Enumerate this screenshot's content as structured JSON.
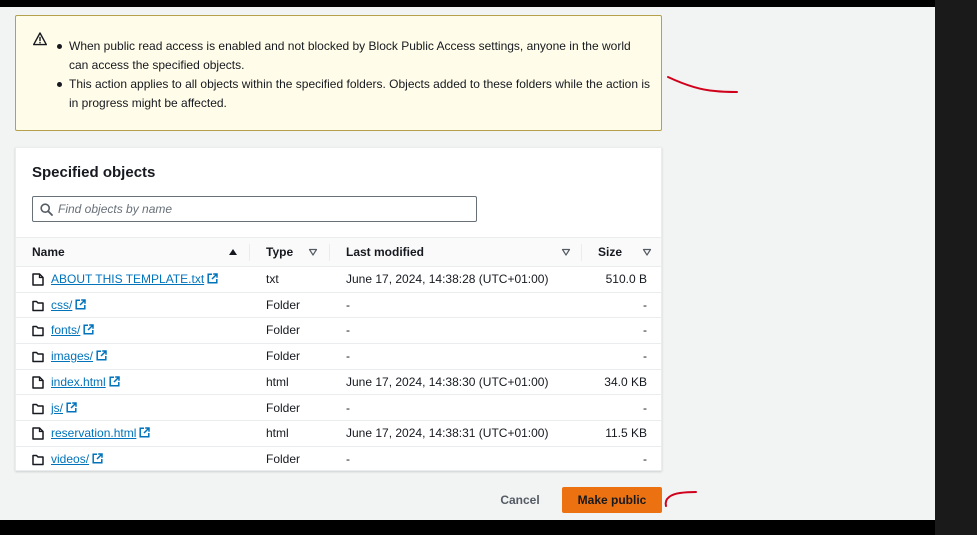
{
  "alert": {
    "icon": "warning-icon",
    "items": [
      "When public read access is enabled and not blocked by Block Public Access settings, anyone in the world can access the specified objects.",
      "This action applies to all objects within the specified folders. Objects added to these folders while the action is in progress might be affected."
    ]
  },
  "panel": {
    "title": "Specified objects",
    "search_placeholder": "Find objects by name",
    "search_value": "",
    "columns": {
      "name": "Name",
      "type": "Type",
      "last_modified": "Last modified",
      "size": "Size"
    },
    "rows": [
      {
        "name": "ABOUT THIS TEMPLATE.txt",
        "kind": "file",
        "type": "txt",
        "last_modified": "June 17, 2024, 14:38:28 (UTC+01:00)",
        "size": "510.0 B"
      },
      {
        "name": "css/",
        "kind": "folder",
        "type": "Folder",
        "last_modified": "-",
        "size": "-"
      },
      {
        "name": "fonts/",
        "kind": "folder",
        "type": "Folder",
        "last_modified": "-",
        "size": "-"
      },
      {
        "name": "images/",
        "kind": "folder",
        "type": "Folder",
        "last_modified": "-",
        "size": "-"
      },
      {
        "name": "index.html",
        "kind": "file",
        "type": "html",
        "last_modified": "June 17, 2024, 14:38:30 (UTC+01:00)",
        "size": "34.0 KB"
      },
      {
        "name": "js/",
        "kind": "folder",
        "type": "Folder",
        "last_modified": "-",
        "size": "-"
      },
      {
        "name": "reservation.html",
        "kind": "file",
        "type": "html",
        "last_modified": "June 17, 2024, 14:38:31 (UTC+01:00)",
        "size": "11.5 KB"
      },
      {
        "name": "videos/",
        "kind": "folder",
        "type": "Folder",
        "last_modified": "-",
        "size": "-"
      }
    ]
  },
  "footer": {
    "cancel_label": "Cancel",
    "primary_label": "Make public"
  },
  "colors": {
    "link": "#0073bb",
    "primary": "#ec7211",
    "alert_bg": "#fffce9",
    "alert_border": "#b5a14d",
    "annotation": "#d0021b"
  }
}
